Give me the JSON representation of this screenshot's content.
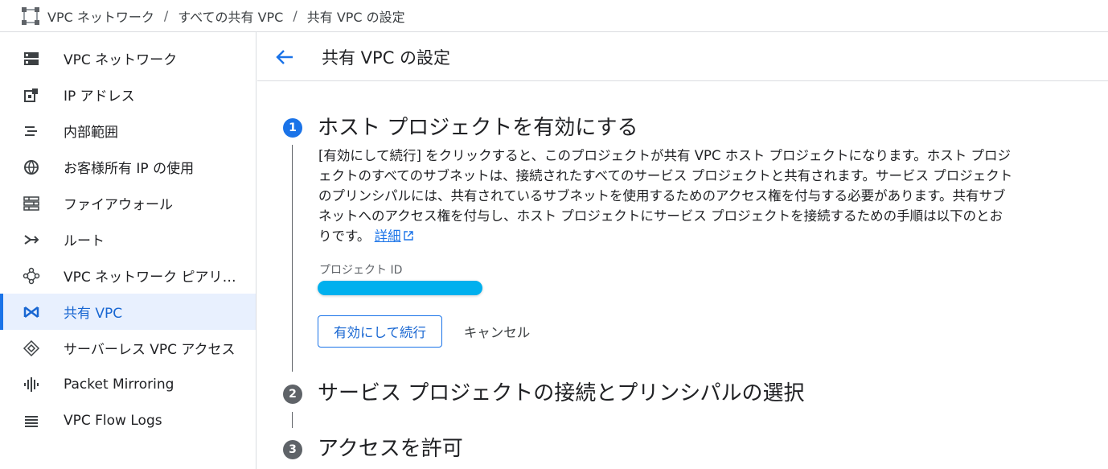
{
  "breadcrumb": {
    "items": [
      "VPC ネットワーク",
      "すべての共有 VPC",
      "共有 VPC の設定"
    ],
    "separator": "/"
  },
  "sidebar": {
    "items": [
      {
        "label": "VPC ネットワーク",
        "icon": "vpc-network-icon"
      },
      {
        "label": "IP アドレス",
        "icon": "ip-address-icon"
      },
      {
        "label": "内部範囲",
        "icon": "internal-ranges-icon"
      },
      {
        "label": "お客様所有 IP の使用",
        "icon": "globe-icon"
      },
      {
        "label": "ファイアウォール",
        "icon": "firewall-icon"
      },
      {
        "label": "ルート",
        "icon": "routes-icon"
      },
      {
        "label": "VPC ネットワーク ピアリング",
        "icon": "peering-icon"
      },
      {
        "label": "共有 VPC",
        "icon": "shared-vpc-icon",
        "active": true
      },
      {
        "label": "サーバーレス VPC アクセス",
        "icon": "serverless-icon"
      },
      {
        "label": "Packet Mirroring",
        "icon": "packet-mirroring-icon"
      },
      {
        "label": "VPC Flow Logs",
        "icon": "flow-logs-icon"
      }
    ]
  },
  "header": {
    "title": "共有 VPC の設定"
  },
  "steps": [
    {
      "number": "1",
      "title": "ホスト プロジェクトを有効にする",
      "description_lines": [
        "[有効にして続行] をクリックすると、このプロジェクトが共有 VPC ホスト プロジェクトになります。ホスト プロジ",
        "ェクトのすべてのサブネットは、接続されたすべてのサービス プロジェクトと共有されます。サービス プロジェクト",
        "のプリンシパルには、共有されているサブネットを使用するためのアクセス権を付与する必要があります。共有サブ",
        "ネットへのアクセス権を付与し、ホスト プロジェクトにサービス プロジェクトを接続するための手順は以下のとお"
      ],
      "description_last": "りです。",
      "learn_more": "詳細",
      "field_label": "プロジェクト ID",
      "enable_button": "有効にして続行",
      "cancel_button": "キャンセル"
    },
    {
      "number": "2",
      "title": "サービス プロジェクトの接続とプリンシパルの選択"
    },
    {
      "number": "3",
      "title": "アクセスを許可"
    }
  ],
  "colors": {
    "accent": "#1a73e8",
    "active_bg": "#e8f0fe",
    "redaction": "#00b0ee"
  }
}
